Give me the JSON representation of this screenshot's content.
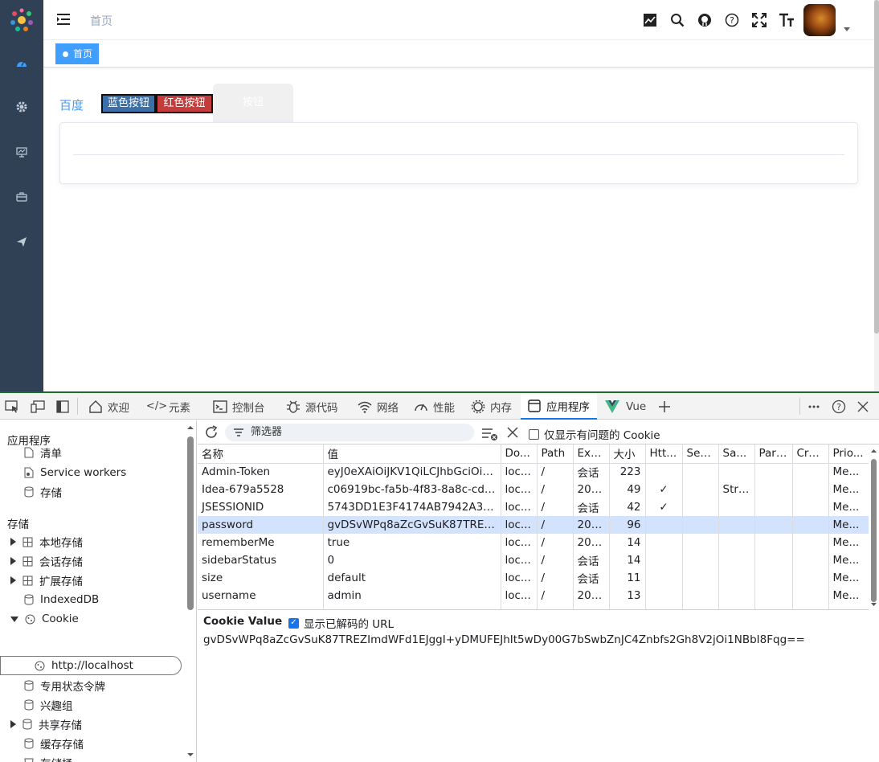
{
  "app": {
    "breadcrumb": "首页",
    "tag_label": "首页",
    "link_label": "百度",
    "blue_button": "蓝色按钮",
    "red_button": "红色按钮",
    "tab_button": "按钮"
  },
  "devtools": {
    "tabs": [
      "欢迎",
      "元素",
      "控制台",
      "源代码",
      "网络",
      "性能",
      "内存",
      "应用程序",
      "Vue"
    ],
    "filter_placeholder": "筛选器",
    "only_issues_label": "仅显示有问题的 Cookie",
    "tree": {
      "app_header": "应用程序",
      "manifest": "清单",
      "service_workers": "Service workers",
      "storage_item": "存储",
      "storage_header": "存储",
      "local_storage": "本地存储",
      "session_storage": "会话存储",
      "extension_storage": "扩展存储",
      "indexeddb": "IndexedDB",
      "cookie": "Cookie",
      "cookie_origin": "http://localhost",
      "private_tokens": "专用状态令牌",
      "interest_groups": "兴趣组",
      "shared_storage": "共享存储",
      "cache_storage": "缓存存储",
      "storage_buckets": "存储桶"
    },
    "columns": [
      "名称",
      "值",
      "Do...",
      "Path",
      "Exp...",
      "大小",
      "Htt...",
      "Sec...",
      "Sa...",
      "Part...",
      "Cro...",
      "Prio..."
    ],
    "rows": [
      [
        "Admin-Token",
        "eyJ0eXAiOiJKV1QiLCJhbGciOiJI...",
        "loc...",
        "/",
        "会话",
        "223",
        "",
        "",
        "",
        "",
        "",
        "Me..."
      ],
      [
        "Idea-679a5528",
        "c06919bc-fa5b-4f83-8a8c-cd0b...",
        "loc...",
        "/",
        "202...",
        "49",
        "✓",
        "",
        "Strict",
        "",
        "",
        "Me..."
      ],
      [
        "JSESSIONID",
        "5743DD1E3F4174AB7942A311...",
        "loc...",
        "/",
        "会话",
        "42",
        "✓",
        "",
        "",
        "",
        "",
        "Me..."
      ],
      [
        "password",
        "gvDSvWPq8aZcGvSuK87TREZI...",
        "loc...",
        "/",
        "202...",
        "96",
        "",
        "",
        "",
        "",
        "",
        "Me..."
      ],
      [
        "rememberMe",
        "true",
        "loc...",
        "/",
        "202...",
        "14",
        "",
        "",
        "",
        "",
        "",
        "Me..."
      ],
      [
        "sidebarStatus",
        "0",
        "loc...",
        "/",
        "会话",
        "14",
        "",
        "",
        "",
        "",
        "",
        "Me..."
      ],
      [
        "size",
        "default",
        "loc...",
        "/",
        "会话",
        "11",
        "",
        "",
        "",
        "",
        "",
        "Me..."
      ],
      [
        "username",
        "admin",
        "loc...",
        "/",
        "202...",
        "13",
        "",
        "",
        "",
        "",
        "",
        "Me..."
      ]
    ],
    "selected_row": 3,
    "cookie_value_title": "Cookie Value",
    "show_decoded_label": "显示已解码的 URL",
    "cookie_value": "gvDSvWPq8aZcGvSuK87TREZImdWFd1EJggI+yDMUFEJhIt5wDy00G7bSwbZnJC4Znbfs2Gh8V2jOi1NBbI8Fqg=="
  }
}
